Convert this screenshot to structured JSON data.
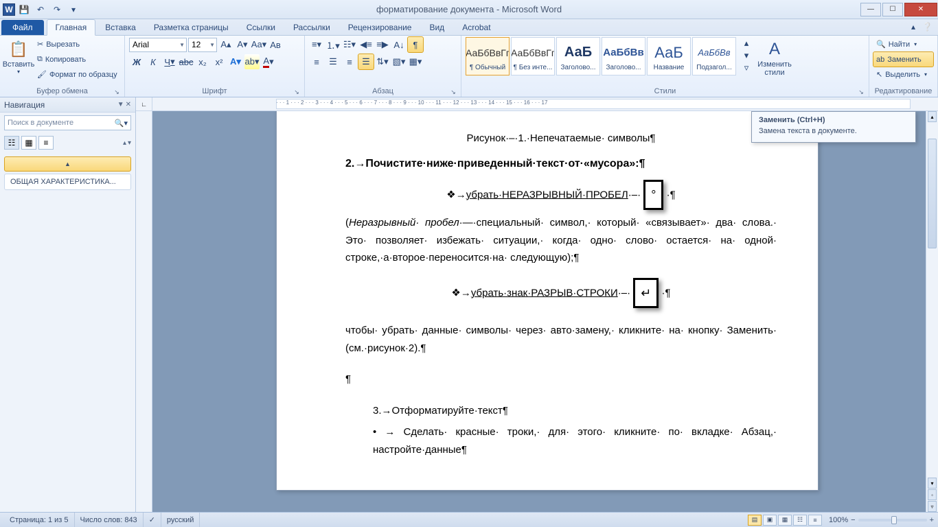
{
  "title": "форматирование документа - Microsoft Word",
  "qat": {
    "save": "💾",
    "undo": "↶",
    "redo": "↷"
  },
  "tabs": {
    "file": "Файл",
    "items": [
      "Главная",
      "Вставка",
      "Разметка страницы",
      "Ссылки",
      "Рассылки",
      "Рецензирование",
      "Вид",
      "Acrobat"
    ],
    "activeIndex": 0
  },
  "ribbon": {
    "clipboard": {
      "label": "Буфер обмена",
      "paste": "Вставить",
      "cut": "Вырезать",
      "copy": "Копировать",
      "format_painter": "Формат по образцу"
    },
    "font": {
      "label": "Шрифт",
      "name": "Arial",
      "size": "12",
      "bold": "Ж",
      "italic": "К",
      "underline": "Ч",
      "strike": "abc",
      "sub": "x₂",
      "sup": "x²"
    },
    "para": {
      "label": "Абзац"
    },
    "styles": {
      "label": "Стили",
      "items": [
        {
          "preview": "АаБбВвГг",
          "name": "¶ Обычный"
        },
        {
          "preview": "АаБбВвГг",
          "name": "¶ Без инте..."
        },
        {
          "preview": "АаБ",
          "name": "Заголово..."
        },
        {
          "preview": "АаБбВв",
          "name": "Заголово..."
        },
        {
          "preview": "АаБ",
          "name": "Название"
        },
        {
          "preview": "АаБбВв",
          "name": "Подзагол..."
        }
      ],
      "change": "Изменить\nстили"
    },
    "editing": {
      "label": "Редактирование",
      "find": "Найти",
      "replace": "Заменить",
      "select": "Выделить"
    }
  },
  "nav": {
    "title": "Навигация",
    "search_placeholder": "Поиск в документе",
    "collapse_item": "▲",
    "heading_item": "ОБЩАЯ ХАРАКТЕРИСТИКА..."
  },
  "doc": {
    "caption": "Рисунок·–·1.·Непечатаемые· символы¶",
    "heading": "2.→Почистите·ниже·приведенный·текст·от·«мусора»:¶",
    "bullet1_pre": "❖→",
    "bullet1_link": "убрать·НЕРАЗРЫВНЫЙ·ПРОБЕЛ",
    "bullet1_post": "·–· ",
    "box1": "°",
    "bullet1_end": " ·¶",
    "para1": "(Неразрывный· пробел·—·специальный· символ,· который· «связывает»· два· слова.· Это· позволяет· избежать· ситуации,· когда· одно· слово· остается· на· одной· строке,·а·второе·переносится·на· следующую);¶",
    "bullet2_pre": "❖→",
    "bullet2_link": "убрать·знак·РАЗРЫВ·СТРОКИ",
    "bullet2_post": "·–· ",
    "box2": "↵",
    "bullet2_end": " ·¶",
    "para2": "чтобы· убрать· данные· символы· через· авто·замену,· кликните· на· кнопку· Заменить· (см.·рисунок·2).¶",
    "blank": "¶",
    "item3": "3.→Отформатируйте·текст¶",
    "item3b": "• → Сделать· красные· троки,· для· этого· кликните· по· вкладке· Абзац,· настройте·данные¶"
  },
  "tooltip": {
    "title": "Заменить (Ctrl+H)",
    "body": "Замена текста в документе."
  },
  "status": {
    "page": "Страница: 1 из 5",
    "words": "Число слов: 843",
    "lang": "русский",
    "zoom": "100%"
  },
  "ruler_ticks": "· · · 1 · · · 2 · · · 3 · · · 4 · · · 5 · · · 6 · · · 7 · · · 8 · · · 9 · · · 10 · · · 11 · · · 12 · · · 13 · · · 14 · · · 15 · · · 16 · · · 17"
}
